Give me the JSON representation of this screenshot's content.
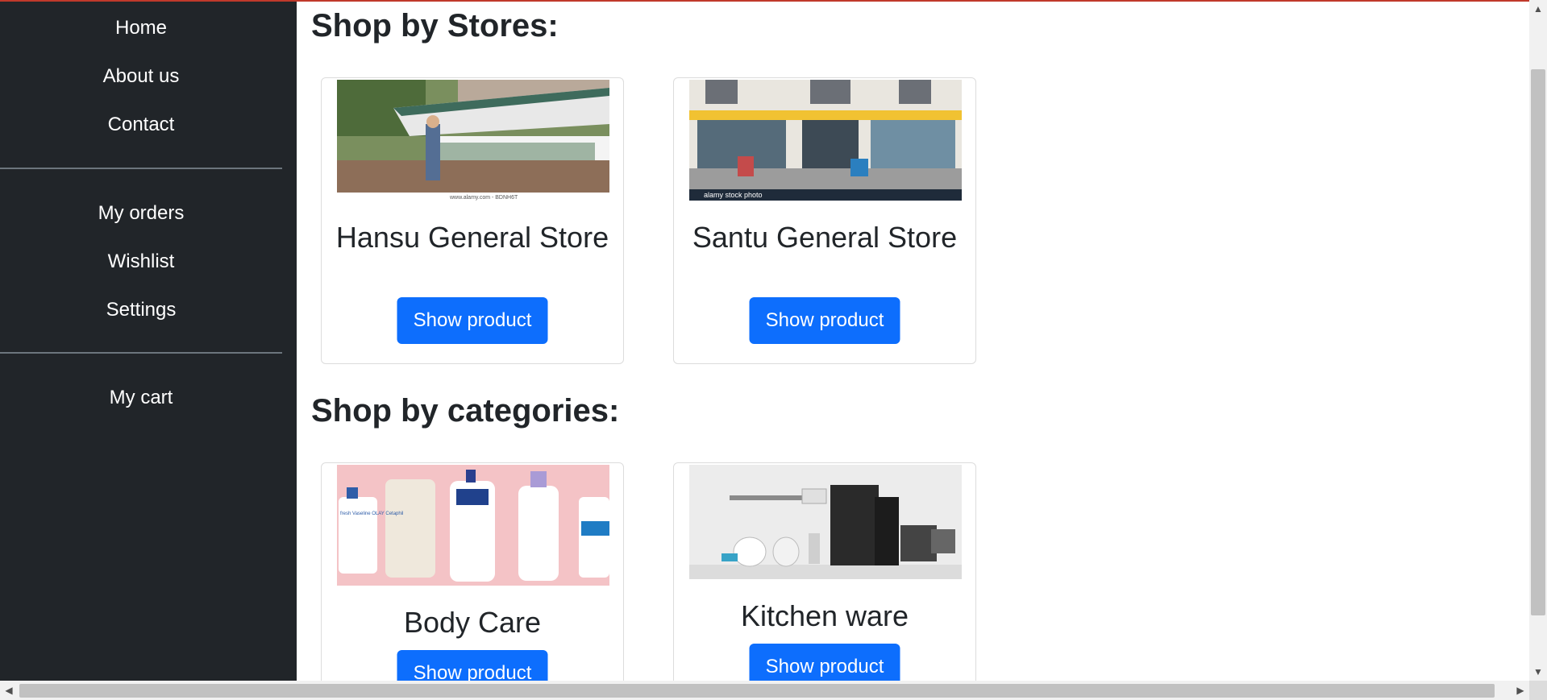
{
  "sidebar": {
    "primary": [
      "Home",
      "About us",
      "Contact"
    ],
    "account": [
      "My orders",
      "Wishlist",
      "Settings"
    ],
    "cart": "My cart"
  },
  "sections": {
    "stores_title": "Shop by Stores:",
    "categories_title": "Shop by categories:"
  },
  "stores": [
    {
      "name": "Hansu General Store",
      "button": "Show product",
      "image_text": "www.alamy.com - BDNH6T"
    },
    {
      "name": "Santu General Store",
      "button": "Show product",
      "image_text": "alamy stock photo"
    }
  ],
  "categories": [
    {
      "name": "Body Care",
      "button": "Show product",
      "image_text": "fresh  Vaseline  OLAY  Cetaphil"
    },
    {
      "name": "Kitchen ware",
      "button": "Show product"
    }
  ],
  "colors": {
    "sidebar_bg": "#212529",
    "primary_button": "#0d6efd",
    "top_accent": "#c0392b"
  }
}
